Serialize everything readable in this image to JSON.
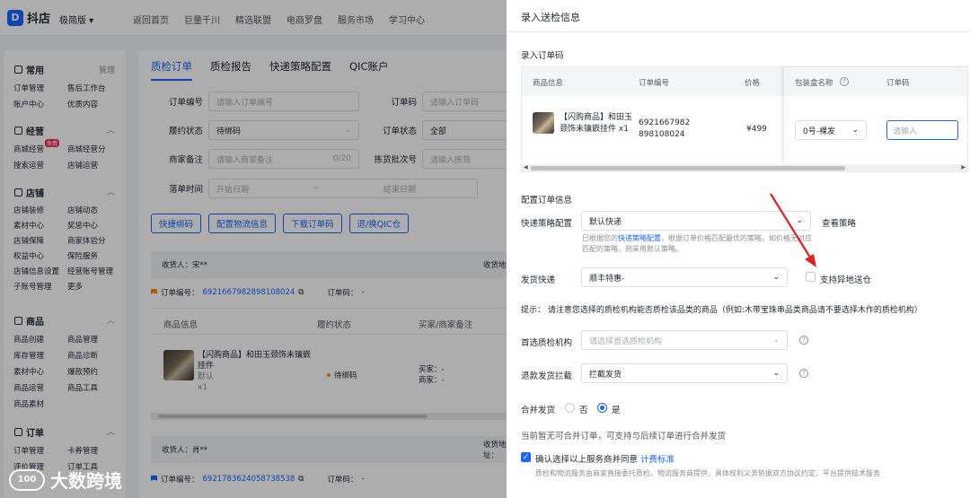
{
  "header": {
    "logo_text": "抖店",
    "edition": "极简版",
    "nav": [
      "返回首页",
      "巨量千川",
      "精选联盟",
      "电商罗盘",
      "服务市场",
      "学习中心"
    ]
  },
  "sidebar": {
    "sections": [
      {
        "title": "常用",
        "right": "管理",
        "items": [
          "订单管理",
          "售后工作台",
          "账户中心",
          "优质内容"
        ]
      },
      {
        "title": "经营",
        "items": [
          "商城经营",
          "商城经营分",
          "搜索运营",
          "店铺运营"
        ],
        "badge": "免费"
      },
      {
        "title": "店铺",
        "items": [
          "店铺装修",
          "店铺动态",
          "素材中心",
          "奖惩中心",
          "店铺保障",
          "商家体验分",
          "权益中心",
          "保险服务",
          "店铺信息设置",
          "经营账号管理",
          "子账号管理",
          "更多"
        ]
      },
      {
        "title": "商品",
        "items": [
          "商品创建",
          "商品管理",
          "库存管理",
          "商品诊断",
          "素材中心",
          "爆款预约",
          "商品运营",
          "商品工具",
          "商品素材"
        ]
      },
      {
        "title": "订单",
        "items": [
          "订单管理",
          "卡券管理",
          "评价管理",
          "订单工具"
        ]
      }
    ]
  },
  "main": {
    "tabs": [
      "质检订单",
      "质检报告",
      "快递策略配置",
      "QIC账户"
    ],
    "filters": {
      "order_no_label": "订单编号",
      "order_no_placeholder": "请输入订单编号",
      "order_code_label": "订单码",
      "order_code_placeholder": "请输入订单码",
      "fulfil_label": "履约状态",
      "fulfil_value": "待绑码",
      "order_status_label": "订单状态",
      "order_status_value": "全部",
      "remark_label": "商家备注",
      "remark_placeholder": "请输入商家备注",
      "remark_count": "0/20",
      "batch_label": "拣货批次号",
      "batch_placeholder": "请输入拣货",
      "time_label": "落单时间",
      "time_start": "开始日期",
      "time_sep": "~",
      "time_end": "结束日期"
    },
    "buttons": [
      "快捷绑码",
      "配置物流信息",
      "下载订单码",
      "退/换QIC仓"
    ],
    "orders": [
      {
        "receiver": "收货人：宋**",
        "address_label": "收货地",
        "order_label": "订单编号：",
        "order_no": "6921667982898108024",
        "code_label": "订单码：",
        "code_value": "-",
        "product": "【闪购商品】和田玉颈饰未镶嵌挂件",
        "spec": "默认",
        "qty": "x1",
        "status": "待绑码",
        "buyer": "买家：-",
        "merchant": "商家：-"
      },
      {
        "receiver": "收货人：肖**",
        "address_label": "收货地址：",
        "order_label": "订单编号：",
        "order_no": "6921783624058738538",
        "code_label": "订单码：",
        "code_value": "-"
      }
    ],
    "table_headers": [
      "商品信息",
      "履约状态",
      "买家/商家备注"
    ]
  },
  "drawer": {
    "title": "录入送检信息",
    "order_code_section": "录入订单码",
    "table": {
      "headers": [
        "商品信息",
        "订单编号",
        "价格",
        "包装盒名称",
        "订单码"
      ],
      "row": {
        "product": "【闪购商品】和田玉颈饰未镶嵌挂件",
        "qty": "x1",
        "order_no_1": "6921667982",
        "order_no_2": "898108024",
        "price": "¥499",
        "box": "0号-裸发",
        "code_placeholder": "请输入"
      }
    },
    "config_section": "配置订单信息",
    "strategy_label": "快递策略配置",
    "strategy_value": "默认快递",
    "strategy_link": "查看策略",
    "strategy_note_1": "已根据您的",
    "strategy_note_link": "快递策略配置",
    "strategy_note_2": "，根据订单价格匹配最优的策略，如价格无对应",
    "strategy_note_3": "匹配的策略，则采用默认策略。",
    "express_label": "发货快递",
    "express_value": "顺丰特惠-",
    "remote_label": "支持异地送仓",
    "tip": "提示：  请注意您选择的质检机构能否质检该品类的商品（例如:木带宝珠串品类商品请不要选择木作的质检机构）",
    "org_label": "首选质检机构",
    "org_placeholder": "请选择首选质检机构",
    "intercept_label": "退款发货拦截",
    "intercept_value": "拦截发货",
    "merge_label": "合并发货",
    "merge_no": "否",
    "merge_yes": "是",
    "merge_note": "当前暂无可合并订单，可支持与后续订单进行合并发货",
    "agree_text": "确认选择以上服务商并同意",
    "agree_link": "计费标准",
    "agree_note": "质检和物流服务由商家直接委托质检、物流服务商提供，具体权利义务依据双方协议约定，平台提供技术服务"
  },
  "watermark": {
    "logo": "100",
    "text": "大数跨境"
  },
  "colors": {
    "accent": "#1966ff",
    "annotation": "#e02020"
  }
}
